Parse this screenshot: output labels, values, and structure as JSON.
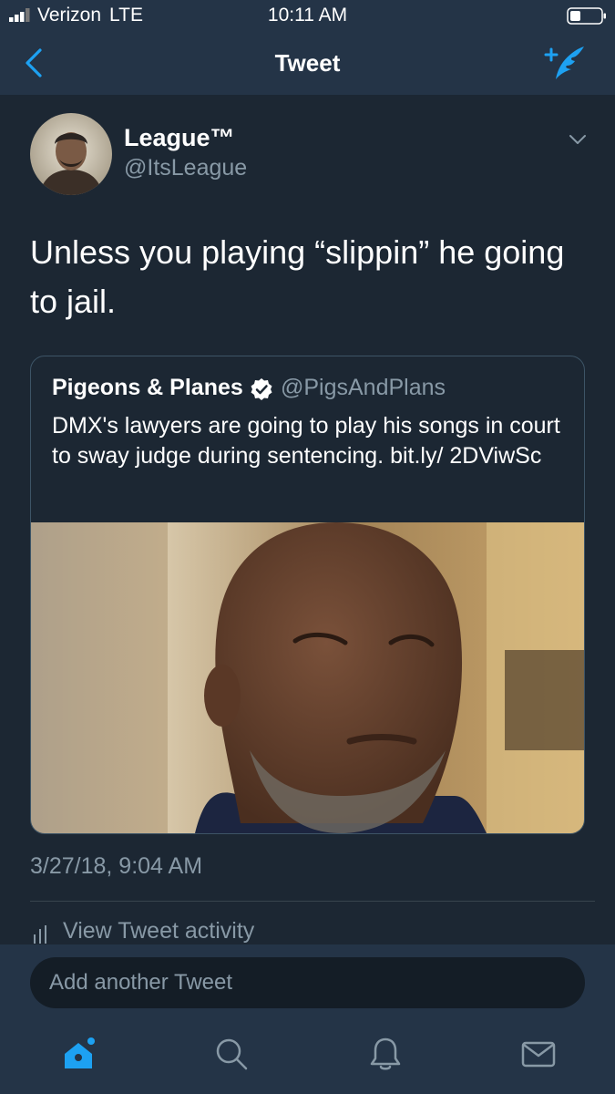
{
  "status_bar": {
    "carrier": "Verizon",
    "network": "LTE",
    "time": "10:11 AM"
  },
  "nav": {
    "title": "Tweet",
    "back_icon": "chevron-left-icon",
    "compose_icon": "compose-tweet-icon"
  },
  "tweet": {
    "author_name": "League™",
    "author_handle": "@ItsLeague",
    "text": "Unless you playing “slippin” he going to jail.",
    "timestamp": "3/27/18, 9:04 AM",
    "view_activity_label": "View Tweet activity"
  },
  "quoted_tweet": {
    "author_name": "Pigeons & Planes",
    "verified": true,
    "author_handle": "@PigsAndPlans",
    "text": "DMX's lawyers are going to play his songs in court to sway judge during sentencing. bit.ly/ 2DViwSc"
  },
  "reply": {
    "placeholder": "Add another Tweet"
  },
  "tab_bar": {
    "items": [
      "home-icon",
      "search-icon",
      "notifications-icon",
      "messages-icon"
    ],
    "active": "home-icon"
  },
  "colors": {
    "background": "#1c2733",
    "bar": "#243447",
    "accent": "#1da1f2",
    "secondary_text": "#8899a6"
  }
}
